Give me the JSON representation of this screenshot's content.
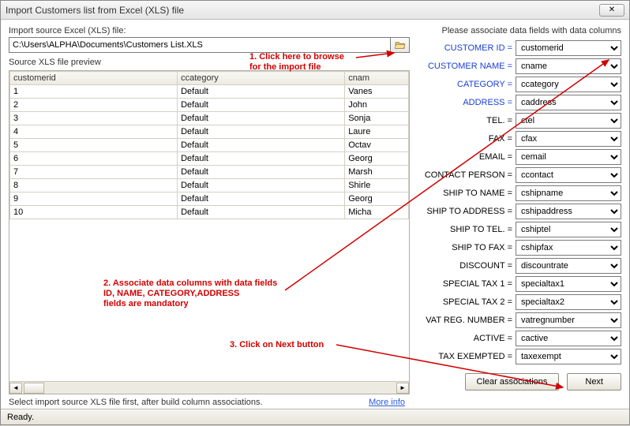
{
  "window": {
    "title": "Import Customers list from Excel (XLS) file"
  },
  "left": {
    "sourceLabel": "Import source Excel (XLS) file:",
    "sourcePath": "C:\\Users\\ALPHA\\Documents\\Customers List.XLS",
    "previewLabel": "Source XLS file preview",
    "columns": [
      "customerid",
      "ccategory",
      "cnam"
    ],
    "rows": [
      [
        "1",
        "Default",
        "Vanes"
      ],
      [
        "2",
        "Default",
        "John"
      ],
      [
        "3",
        "Default",
        "Sonja"
      ],
      [
        "4",
        "Default",
        "Laure"
      ],
      [
        "5",
        "Default",
        "Octav"
      ],
      [
        "6",
        "Default",
        "Georg"
      ],
      [
        "7",
        "Default",
        "Marsh"
      ],
      [
        "8",
        "Default",
        "Shirle"
      ],
      [
        "9",
        "Default",
        "Georg"
      ],
      [
        "10",
        "Default",
        "Micha"
      ]
    ],
    "footerText": "Select import source XLS file first, after build column associations.",
    "moreInfo": "More info"
  },
  "right": {
    "title": "Please associate data fields with data columns",
    "fields": [
      {
        "label": "CUSTOMER ID =",
        "value": "customerid",
        "mandatory": true
      },
      {
        "label": "CUSTOMER NAME =",
        "value": "cname",
        "mandatory": true
      },
      {
        "label": "CATEGORY =",
        "value": "ccategory",
        "mandatory": true
      },
      {
        "label": "ADDRESS =",
        "value": "caddress",
        "mandatory": true
      },
      {
        "label": "TEL. =",
        "value": "ctel",
        "mandatory": false
      },
      {
        "label": "FAX =",
        "value": "cfax",
        "mandatory": false
      },
      {
        "label": "EMAIL =",
        "value": "cemail",
        "mandatory": false
      },
      {
        "label": "CONTACT PERSON =",
        "value": "ccontact",
        "mandatory": false
      },
      {
        "label": "SHIP TO NAME =",
        "value": "cshipname",
        "mandatory": false
      },
      {
        "label": "SHIP TO ADDRESS =",
        "value": "cshipaddress",
        "mandatory": false
      },
      {
        "label": "SHIP TO TEL. =",
        "value": "cshiptel",
        "mandatory": false
      },
      {
        "label": "SHIP TO FAX =",
        "value": "cshipfax",
        "mandatory": false
      },
      {
        "label": "DISCOUNT =",
        "value": "discountrate",
        "mandatory": false
      },
      {
        "label": "SPECIAL TAX 1 =",
        "value": "specialtax1",
        "mandatory": false
      },
      {
        "label": "SPECIAL TAX 2 =",
        "value": "specialtax2",
        "mandatory": false
      },
      {
        "label": "VAT REG. NUMBER =",
        "value": "vatregnumber",
        "mandatory": false
      },
      {
        "label": "ACTIVE =",
        "value": "cactive",
        "mandatory": false
      },
      {
        "label": "TAX EXEMPTED =",
        "value": "taxexempt",
        "mandatory": false
      }
    ],
    "clearBtn": "Clear associations",
    "nextBtn": "Next"
  },
  "annotations": {
    "a1": "1. Click here to browse\nfor the import file",
    "a2": "2. Associate data columns with data fields\nID, NAME, CATEGORY,ADDRESS\nfields are mandatory",
    "a3": "3. Click on Next button"
  },
  "status": "Ready."
}
